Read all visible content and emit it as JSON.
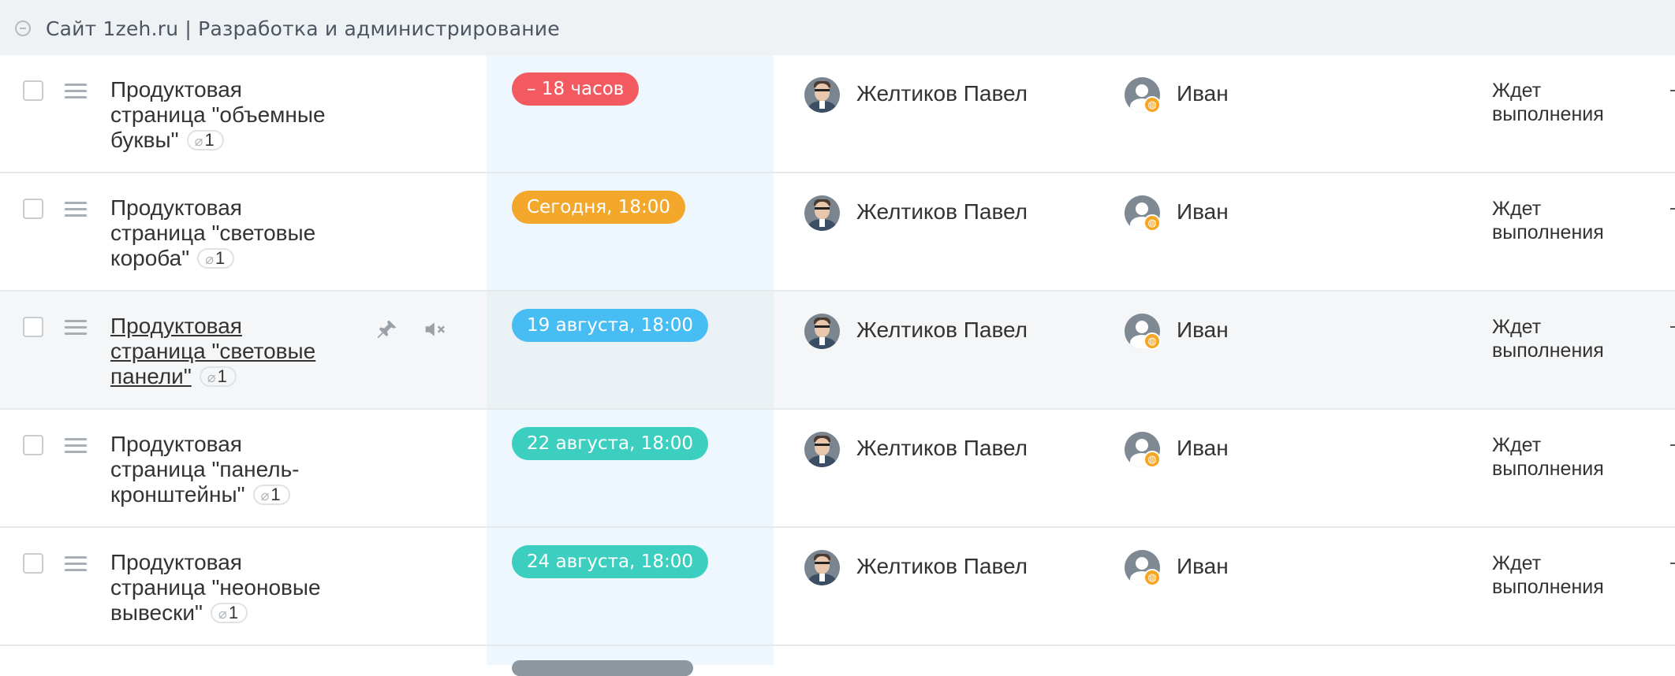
{
  "group": {
    "title": "Сайт 1zeh.ru | Разработка и администрирование"
  },
  "tasks": [
    {
      "title": "Продуктовая страница \"объемные буквы\"",
      "attachments": "1",
      "deadline": "– 18 часов",
      "deadline_color": "#f35a5f",
      "assignee": "Желтиков Павел",
      "creator": "Иван",
      "status": "Ждет выполнения"
    },
    {
      "title": "Продуктовая страница \"световые короба\"",
      "attachments": "1",
      "deadline": "Сегодня, 18:00",
      "deadline_color": "#f3a72b",
      "assignee": "Желтиков Павел",
      "creator": "Иван",
      "status": "Ждет выполнения"
    },
    {
      "title": "Продуктовая страница \"световые панели\"",
      "attachments": "1",
      "deadline": "19 августа, 18:00",
      "deadline_color": "#48bdf3",
      "assignee": "Желтиков Павел",
      "creator": "Иван",
      "status": "Ждет выполнения"
    },
    {
      "title": "Продуктовая страница \"панель-кронштейны\"",
      "attachments": "1",
      "deadline": "22 августа, 18:00",
      "deadline_color": "#3ccfc0",
      "assignee": "Желтиков Павел",
      "creator": "Иван",
      "status": "Ждет выполнения"
    },
    {
      "title": "Продуктовая страница \"неоновые вывески\"",
      "attachments": "1",
      "deadline": "24 августа, 18:00",
      "deadline_color": "#3ccfc0",
      "assignee": "Желтиков Павел",
      "creator": "Иван",
      "status": "Ждет выполнения"
    }
  ],
  "icons": {
    "collapse": "minus-circle-icon",
    "drag": "drag-handle-icon",
    "attachment": "paperclip-icon",
    "pin": "pin-icon",
    "mute": "mute-icon",
    "creator_badge": "globe-icon"
  }
}
